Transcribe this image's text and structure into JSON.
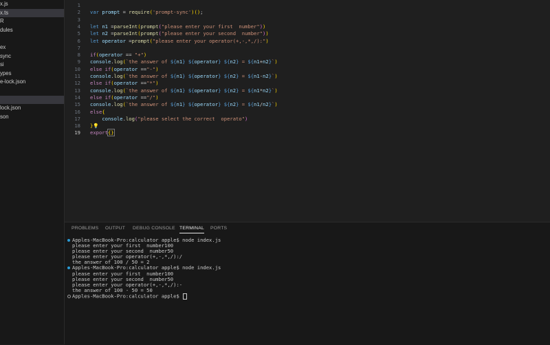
{
  "sidebar": {
    "items": [
      {
        "label": "x.js",
        "active": false
      },
      {
        "label": "x.ts",
        "active": true
      },
      {
        "label": "R",
        "active": false
      },
      {
        "label": "dules",
        "active": false
      },
      {
        "label": "",
        "active": false
      },
      {
        "label": "ex",
        "active": false
      },
      {
        "label": "sync",
        "active": false
      },
      {
        "label": "si",
        "active": false
      },
      {
        "label": "ypes",
        "active": false
      },
      {
        "label": "e-lock.json",
        "active": false
      },
      {
        "label": "",
        "active": false
      },
      {
        "label": "",
        "active": true
      },
      {
        "label": "lock.json",
        "active": false
      },
      {
        "label": "son",
        "active": false
      }
    ]
  },
  "editor": {
    "current_line": 19,
    "lines": [
      {
        "n": "1",
        "tokens": []
      },
      {
        "n": "2",
        "tokens": [
          [
            "kw",
            "var"
          ],
          [
            "p",
            " "
          ],
          [
            "var",
            "prompt"
          ],
          [
            "p",
            " = "
          ],
          [
            "fn",
            "require"
          ],
          [
            "b1",
            "("
          ],
          [
            "str",
            "'prompt-sync'"
          ],
          [
            "b1",
            ")"
          ],
          [
            "b1",
            "("
          ],
          [
            "b1",
            ")"
          ],
          [
            "p",
            ";"
          ]
        ]
      },
      {
        "n": "3",
        "tokens": []
      },
      {
        "n": "4",
        "tokens": [
          [
            "kw",
            "let"
          ],
          [
            "p",
            " "
          ],
          [
            "var",
            "n1"
          ],
          [
            "p",
            " ="
          ],
          [
            "fn",
            "parseInt"
          ],
          [
            "b1",
            "("
          ],
          [
            "fn",
            "prompt"
          ],
          [
            "b2",
            "("
          ],
          [
            "str",
            "\"please enter your first  number\""
          ],
          [
            "b2",
            ")"
          ],
          [
            "b1",
            ")"
          ]
        ]
      },
      {
        "n": "5",
        "tokens": [
          [
            "kw",
            "let"
          ],
          [
            "p",
            " "
          ],
          [
            "var",
            "n2"
          ],
          [
            "p",
            " ="
          ],
          [
            "fn",
            "parseInt"
          ],
          [
            "b1",
            "("
          ],
          [
            "fn",
            "prompt"
          ],
          [
            "b2",
            "("
          ],
          [
            "str",
            "\"please enter your second  number\""
          ],
          [
            "b2",
            ")"
          ],
          [
            "b1",
            ")"
          ]
        ]
      },
      {
        "n": "6",
        "tokens": [
          [
            "kw",
            "let"
          ],
          [
            "p",
            " "
          ],
          [
            "var",
            "operator"
          ],
          [
            "p",
            " ="
          ],
          [
            "fn",
            "prompt"
          ],
          [
            "b1",
            "("
          ],
          [
            "str",
            "\"please enter your operator(+,-,*,/):\""
          ],
          [
            "b1",
            ")"
          ]
        ]
      },
      {
        "n": "7",
        "tokens": []
      },
      {
        "n": "8",
        "tokens": [
          [
            "kw2",
            "if"
          ],
          [
            "b1",
            "("
          ],
          [
            "var",
            "operator"
          ],
          [
            "p",
            " == "
          ],
          [
            "str",
            "\"+\""
          ],
          [
            "b1",
            ")"
          ]
        ]
      },
      {
        "n": "9",
        "tokens": [
          [
            "var",
            "console"
          ],
          [
            "p",
            "."
          ],
          [
            "fn",
            "log"
          ],
          [
            "b1",
            "("
          ],
          [
            "str",
            "`the answer of "
          ],
          [
            "ph",
            "${"
          ],
          [
            "var",
            "n1"
          ],
          [
            "ph",
            "}"
          ],
          [
            "str",
            " "
          ],
          [
            "ph",
            "${"
          ],
          [
            "var",
            "operator"
          ],
          [
            "ph",
            "}"
          ],
          [
            "str",
            " "
          ],
          [
            "ph",
            "${"
          ],
          [
            "var",
            "n2"
          ],
          [
            "ph",
            "}"
          ],
          [
            "str",
            " = "
          ],
          [
            "ph",
            "${"
          ],
          [
            "var",
            "n1"
          ],
          [
            "p",
            "+"
          ],
          [
            "var",
            "n2"
          ],
          [
            "ph",
            "}"
          ],
          [
            "str",
            "`"
          ],
          [
            "b1",
            ")"
          ]
        ]
      },
      {
        "n": "10",
        "tokens": [
          [
            "kw2",
            "else"
          ],
          [
            "p",
            " "
          ],
          [
            "kw2",
            "if"
          ],
          [
            "b1",
            "("
          ],
          [
            "var",
            "operator"
          ],
          [
            "p",
            " =="
          ],
          [
            "str",
            "\"-\""
          ],
          [
            "b1",
            ")"
          ]
        ]
      },
      {
        "n": "11",
        "tokens": [
          [
            "var",
            "console"
          ],
          [
            "p",
            "."
          ],
          [
            "fn",
            "log"
          ],
          [
            "b1",
            "("
          ],
          [
            "str",
            "`the answer of "
          ],
          [
            "ph",
            "${"
          ],
          [
            "var",
            "n1"
          ],
          [
            "ph",
            "}"
          ],
          [
            "str",
            " "
          ],
          [
            "ph",
            "${"
          ],
          [
            "var",
            "operator"
          ],
          [
            "ph",
            "}"
          ],
          [
            "str",
            " "
          ],
          [
            "ph",
            "${"
          ],
          [
            "var",
            "n2"
          ],
          [
            "ph",
            "}"
          ],
          [
            "str",
            " = "
          ],
          [
            "ph",
            "${"
          ],
          [
            "var",
            "n1"
          ],
          [
            "p",
            "-"
          ],
          [
            "var",
            "n2"
          ],
          [
            "ph",
            "}"
          ],
          [
            "str",
            "`"
          ],
          [
            "b1",
            ")"
          ]
        ]
      },
      {
        "n": "12",
        "tokens": [
          [
            "kw2",
            "else"
          ],
          [
            "p",
            " "
          ],
          [
            "kw2",
            "if"
          ],
          [
            "b1",
            "("
          ],
          [
            "var",
            "operator"
          ],
          [
            "p",
            " =="
          ],
          [
            "str",
            "\"*\""
          ],
          [
            "b1",
            ")"
          ]
        ]
      },
      {
        "n": "13",
        "tokens": [
          [
            "var",
            "console"
          ],
          [
            "p",
            "."
          ],
          [
            "fn",
            "log"
          ],
          [
            "b1",
            "("
          ],
          [
            "str",
            "`the answer of "
          ],
          [
            "ph",
            "${"
          ],
          [
            "var",
            "n1"
          ],
          [
            "ph",
            "}"
          ],
          [
            "str",
            " "
          ],
          [
            "ph",
            "${"
          ],
          [
            "var",
            "operator"
          ],
          [
            "ph",
            "}"
          ],
          [
            "str",
            " "
          ],
          [
            "ph",
            "${"
          ],
          [
            "var",
            "n2"
          ],
          [
            "ph",
            "}"
          ],
          [
            "str",
            " = "
          ],
          [
            "ph",
            "${"
          ],
          [
            "var",
            "n1"
          ],
          [
            "p",
            "*"
          ],
          [
            "var",
            "n2"
          ],
          [
            "ph",
            "}"
          ],
          [
            "str",
            "`"
          ],
          [
            "b1",
            ")"
          ]
        ]
      },
      {
        "n": "14",
        "tokens": [
          [
            "kw2",
            "else"
          ],
          [
            "p",
            " "
          ],
          [
            "kw2",
            "if"
          ],
          [
            "b1",
            "("
          ],
          [
            "var",
            "operator"
          ],
          [
            "p",
            " =="
          ],
          [
            "str",
            "\"/\""
          ],
          [
            "b1",
            ")"
          ]
        ]
      },
      {
        "n": "15",
        "tokens": [
          [
            "var",
            "console"
          ],
          [
            "p",
            "."
          ],
          [
            "fn",
            "log"
          ],
          [
            "b1",
            "("
          ],
          [
            "str",
            "`the answer of "
          ],
          [
            "ph",
            "${"
          ],
          [
            "var",
            "n1"
          ],
          [
            "ph",
            "}"
          ],
          [
            "str",
            " "
          ],
          [
            "ph",
            "${"
          ],
          [
            "var",
            "operator"
          ],
          [
            "ph",
            "}"
          ],
          [
            "str",
            " "
          ],
          [
            "ph",
            "${"
          ],
          [
            "var",
            "n2"
          ],
          [
            "ph",
            "}"
          ],
          [
            "str",
            " = "
          ],
          [
            "ph",
            "${"
          ],
          [
            "var",
            "n1"
          ],
          [
            "p",
            "/"
          ],
          [
            "var",
            "n2"
          ],
          [
            "ph",
            "}"
          ],
          [
            "str",
            "`"
          ],
          [
            "b1",
            ")"
          ]
        ]
      },
      {
        "n": "16",
        "tokens": [
          [
            "kw2",
            "else"
          ],
          [
            "b1",
            "{"
          ]
        ]
      },
      {
        "n": "17",
        "tokens": [
          [
            "p",
            "    "
          ],
          [
            "var",
            "console"
          ],
          [
            "p",
            "."
          ],
          [
            "fn",
            "log"
          ],
          [
            "b2",
            "("
          ],
          [
            "str",
            "\"please select the correct  operato\""
          ],
          [
            "b2",
            ")"
          ]
        ]
      },
      {
        "n": "18",
        "tokens": [
          [
            "b1",
            "}"
          ],
          [
            "bulb",
            "💡"
          ]
        ]
      },
      {
        "n": "19",
        "tokens": [
          [
            "kw2",
            "export"
          ],
          [
            "cur",
            "{}"
          ]
        ]
      }
    ]
  },
  "panel": {
    "tabs": [
      {
        "label": "PROBLEMS",
        "active": false
      },
      {
        "label": "OUTPUT",
        "active": false
      },
      {
        "label": "DEBUG CONSOLE",
        "active": false
      },
      {
        "label": "TERMINAL",
        "active": true
      },
      {
        "label": "PORTS",
        "active": false
      }
    ],
    "terminal_lines": [
      {
        "text": "Apples-MacBook-Pro:calculator apple$ node index.js",
        "marker": "blue"
      },
      {
        "text": "please enter your first  number100",
        "marker": ""
      },
      {
        "text": "please enter your second  number50",
        "marker": ""
      },
      {
        "text": "please enter your operator(+,-,*,/):/",
        "marker": ""
      },
      {
        "text": "the answer of 100 / 50 = 2",
        "marker": ""
      },
      {
        "text": "Apples-MacBook-Pro:calculator apple$ node index.js",
        "marker": "blue"
      },
      {
        "text": "please enter your first  number100",
        "marker": ""
      },
      {
        "text": "please enter your second  number50",
        "marker": ""
      },
      {
        "text": "please enter your operator(+,-,*,/):-",
        "marker": ""
      },
      {
        "text": "the answer of 100 - 50 = 50",
        "marker": ""
      },
      {
        "text": "Apples-MacBook-Pro:calculator apple$ ",
        "marker": "empty",
        "cursor": true
      }
    ]
  }
}
